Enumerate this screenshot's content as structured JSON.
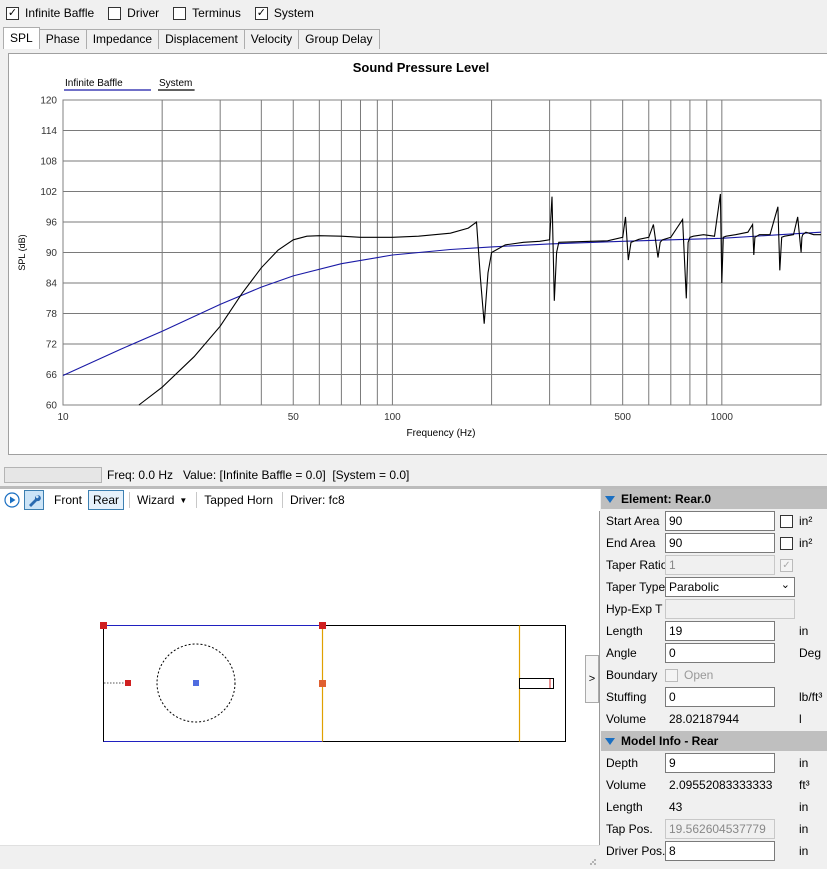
{
  "checkboxes": [
    {
      "label": "Infinite Baffle",
      "checked": true
    },
    {
      "label": "Driver",
      "checked": false
    },
    {
      "label": "Terminus",
      "checked": false
    },
    {
      "label": "System",
      "checked": true
    }
  ],
  "tabs": [
    "SPL",
    "Phase",
    "Impedance",
    "Displacement",
    "Velocity",
    "Group Delay"
  ],
  "active_tab": "SPL",
  "chart_data": {
    "type": "line",
    "title": "Sound Pressure Level",
    "xlabel": "Frequency (Hz)",
    "ylabel": "SPL (dB)",
    "x_scale": "log",
    "xlim": [
      10,
      2000
    ],
    "ylim": [
      60,
      120
    ],
    "x_ticks": [
      "10",
      "50",
      "100",
      "500",
      "1000"
    ],
    "y_ticks": [
      "60",
      "66",
      "72",
      "78",
      "84",
      "90",
      "96",
      "102",
      "108",
      "114",
      "120"
    ],
    "grid": true,
    "legend": [
      "Infinite Baffle",
      "System"
    ],
    "legend_position": "top-left",
    "series": [
      {
        "name": "Infinite Baffle",
        "color": "#1a1aa6",
        "x": [
          10,
          15,
          20,
          30,
          40,
          50,
          70,
          100,
          150,
          200,
          300,
          500,
          700,
          1000,
          1500,
          2000
        ],
        "y": [
          65.8,
          71.0,
          74.5,
          79.8,
          83.2,
          85.4,
          87.8,
          89.5,
          90.6,
          91.1,
          91.7,
          92.2,
          92.5,
          92.8,
          93.5,
          94.0
        ]
      },
      {
        "name": "System",
        "color": "#000000",
        "x": [
          17,
          20,
          25,
          30,
          35,
          40,
          45,
          50,
          55,
          60,
          70,
          80,
          100,
          120,
          150,
          170,
          180,
          185,
          190,
          195,
          200,
          220,
          250,
          280,
          300,
          305,
          310,
          315,
          320,
          400,
          450,
          500,
          510,
          520,
          530,
          560,
          600,
          620,
          640,
          650,
          660,
          700,
          760,
          780,
          790,
          800,
          820,
          880,
          950,
          990,
          1000,
          1010,
          1030,
          1100,
          1200,
          1240,
          1250,
          1260,
          1300,
          1400,
          1480,
          1500,
          1520,
          1550,
          1650,
          1700,
          1740,
          1750,
          1760,
          1800,
          1900,
          2000
        ],
        "y": [
          60,
          63.5,
          69.5,
          75.5,
          82,
          87,
          90.5,
          92.5,
          93.2,
          93.3,
          93.2,
          93.0,
          93.0,
          93.2,
          93.8,
          94.8,
          96.0,
          85.0,
          76.0,
          86.0,
          90.0,
          91.5,
          92.0,
          92.2,
          92.5,
          101.0,
          80.5,
          90.0,
          92.0,
          92.2,
          92.3,
          93.0,
          97.0,
          88.5,
          92.0,
          92.6,
          93.0,
          95.5,
          89.0,
          92.0,
          92.5,
          93.0,
          96.5,
          81.0,
          92.0,
          93.0,
          93.2,
          93.5,
          93.2,
          101.5,
          84.0,
          93.0,
          93.2,
          93.5,
          94.0,
          95.5,
          89.5,
          93.0,
          93.5,
          93.5,
          99.0,
          86.5,
          93.0,
          93.2,
          93.5,
          97.0,
          90.0,
          93.0,
          93.5,
          94.0,
          93.5,
          93.5
        ]
      }
    ]
  },
  "status": {
    "text": "Freq: 0.0 Hz   Value: [Infinite Baffle = 0.0]  [System = 0.0]"
  },
  "toolbar": {
    "front": "Front",
    "rear": "Rear",
    "wizard": "Wizard",
    "tapped_horn": "Tapped Horn",
    "driver": "Driver: fc8"
  },
  "collapse_label": ">",
  "element_section": {
    "title": "Element: Rear.0",
    "rows": [
      {
        "label": "Start Area",
        "value": "90",
        "unit": "in²",
        "checkbox": true
      },
      {
        "label": "End Area",
        "value": "90",
        "unit": "in²",
        "checkbox": true
      },
      {
        "label": "Taper Ratio",
        "value": "1",
        "disabled": true,
        "checkbox_checked_disabled": true
      },
      {
        "label": "Taper Type",
        "value": "Parabolic",
        "select": true
      },
      {
        "label": "Hyp-Exp T",
        "value": "",
        "disabled": true
      },
      {
        "label": "Length",
        "value": "19",
        "unit": "in"
      },
      {
        "label": "Angle",
        "value": "0",
        "unit": "Deg"
      },
      {
        "label": "Boundary",
        "option": "Open"
      },
      {
        "label": "Stuffing",
        "value": "0",
        "unit": "lb/ft³"
      },
      {
        "label": "Volume",
        "value": "28.02187944",
        "unit": "l",
        "readonly": true
      }
    ]
  },
  "model_section": {
    "title": "Model Info - Rear",
    "rows": [
      {
        "label": "Depth",
        "value": "9",
        "unit": "in"
      },
      {
        "label": "Volume",
        "value": "2.09552083333333",
        "unit": "ft³",
        "readonly": true
      },
      {
        "label": "Length",
        "value": "43",
        "unit": "in",
        "readonly": true
      },
      {
        "label": "Tap Pos.",
        "value": "19.562604537779",
        "unit": "in",
        "disabled": true
      },
      {
        "label": "Driver Pos.",
        "value": "8",
        "unit": "in"
      }
    ]
  }
}
